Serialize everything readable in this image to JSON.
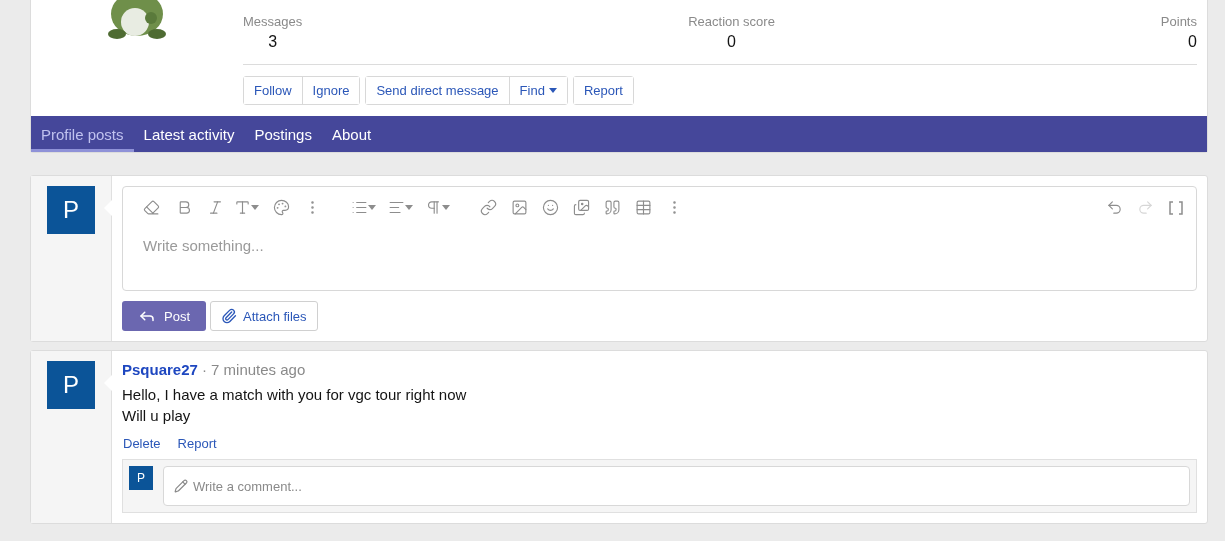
{
  "profile": {
    "stats": [
      {
        "label": "Messages",
        "value": "3"
      },
      {
        "label": "Reaction score",
        "value": "0"
      },
      {
        "label": "Points",
        "value": "0"
      }
    ],
    "button_groups": [
      [
        "Follow",
        "Ignore"
      ],
      [
        "Send direct message",
        "Find"
      ],
      [
        "Report"
      ]
    ]
  },
  "tabs": [
    {
      "label": "Profile posts",
      "selected": true
    },
    {
      "label": "Latest activity",
      "selected": false
    },
    {
      "label": "Postings",
      "selected": false
    },
    {
      "label": "About",
      "selected": false
    }
  ],
  "composer": {
    "avatar": "P",
    "placeholder": "Write something...",
    "redo_disabled": true,
    "post_button": "Post",
    "attach_button": "Attach files"
  },
  "posts": [
    {
      "avatar": "P",
      "author": "Psquare27",
      "time": "· 7 minutes ago",
      "lines": [
        "Hello, I have a match with you for vgc tour right now",
        "Will u play"
      ],
      "actions": [
        "Delete",
        "Report"
      ],
      "comment": {
        "avatar": "P",
        "placeholder": "Write a comment..."
      }
    }
  ]
}
